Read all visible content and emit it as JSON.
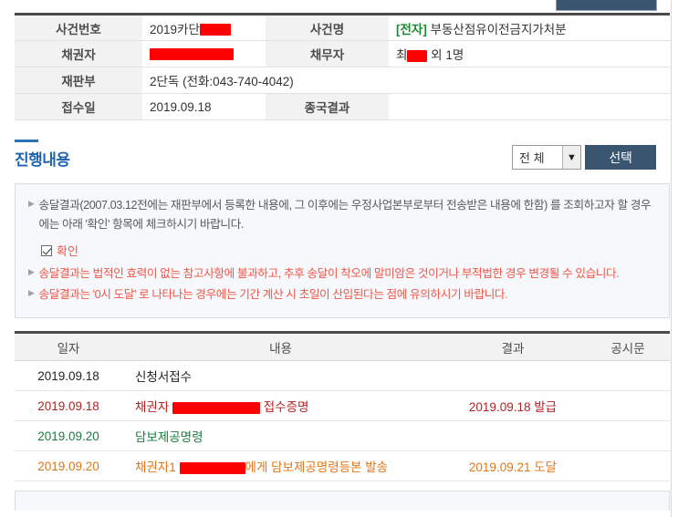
{
  "top_button": {
    "name": "top-action-button"
  },
  "case_info": {
    "rows": [
      {
        "label1": "사건번호",
        "value1_prefix": "2019카단",
        "value1_redacted": true,
        "redact1_width": 34,
        "label2": "사건명",
        "value2_tag": "[전자]",
        "value2": " 부동산점유이전금지가처분",
        "value2_redacted": false
      },
      {
        "label1": "채권자",
        "value1_prefix": "",
        "value1_redacted": true,
        "redact1_width": 92,
        "label2": "채무자",
        "value2_tag": "",
        "value2_prefix": "최",
        "value2_suffix": " 외 1명",
        "value2_redacted": true,
        "redact2_width": 22
      },
      {
        "label1": "재판부",
        "value1_prefix": "2단독 (전화:043-740-4042)",
        "value1_redacted": false,
        "colspan": true
      },
      {
        "label1": "접수일",
        "value1_prefix": "2019.09.18",
        "value1_redacted": false,
        "label2": "종국결과",
        "value2_tag": "",
        "value2": "",
        "value2_redacted": false
      }
    ]
  },
  "section": {
    "title": "진행내용",
    "select_value": "전 체",
    "select_icon": "chevron-down-icon",
    "select_button": "선택"
  },
  "notice": {
    "lines": [
      {
        "style": "gray",
        "text": "송달결과(2007.03.12전에는 재판부에서 등록한 내용에, 그 이후에는 우정사업본부로부터 전송받은 내용에 한함) 를 조회하고자 할 경우에는 아래 '확인' 항목에 체크하시기 바랍니다."
      },
      {
        "style": "red",
        "text": "송달결과는 법적인 효력이 없는 참고사항에 불과하고, 추후 송달이 착오에 말미암은 것이거나 부적법한 경우 변경될 수 있습니다."
      },
      {
        "style": "red",
        "text": "송달결과는 '0시 도달' 로 나타나는 경우에는 기간 계산 시 초일이 산입된다는 점에 유의하시기 바랍니다."
      }
    ],
    "checkbox_label": "확인",
    "checkbox_checked": true
  },
  "progress": {
    "headers": [
      "일자",
      "내용",
      "결과",
      "공시문"
    ],
    "rows": [
      {
        "date": "2019.09.18",
        "desc": "신청서접수",
        "desc_prefix": "신청서접수",
        "desc_suffix": "",
        "redacted": false,
        "redact_width": 0,
        "result": "",
        "doc": "",
        "color": "black"
      },
      {
        "date": "2019.09.18",
        "desc_prefix": "채권자 ",
        "desc_suffix": " 접수증명",
        "redacted": true,
        "redact_width": 96,
        "result": "2019.09.18 발급",
        "doc": "",
        "color": "red"
      },
      {
        "date": "2019.09.20",
        "desc_prefix": "담보제공명령",
        "desc_suffix": "",
        "redacted": false,
        "redact_width": 0,
        "result": "",
        "doc": "",
        "color": "green"
      },
      {
        "date": "2019.09.20",
        "desc_prefix": "채권자1 ",
        "desc_suffix": "에게 담보제공명령등본 발송",
        "redacted": true,
        "redact_width": 72,
        "result": "2019.09.21 도달",
        "doc": "",
        "color": "orange"
      }
    ]
  },
  "colors": {
    "accent_blue": "#1f62ad",
    "button_navy": "#3a5570",
    "notice_red": "#f0584a",
    "tag_green": "#1a8a32",
    "redaction": "#fe0000"
  }
}
